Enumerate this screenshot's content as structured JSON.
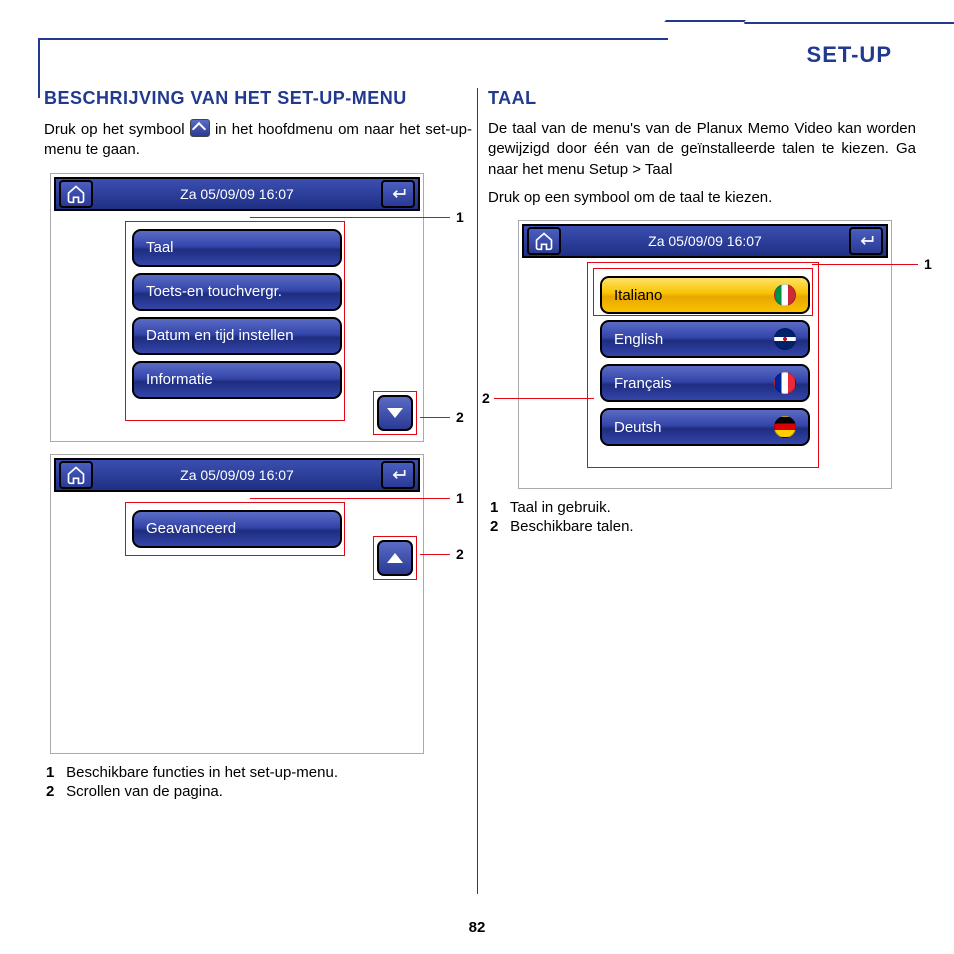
{
  "header": {
    "title": "SET-UP"
  },
  "page_number": "82",
  "left": {
    "heading": "BESCHRIJVING VAN HET SET-UP-MENU",
    "intro_a": "Druk op het symbool ",
    "intro_b": " in het hoofdmenu om naar het set-up-menu te gaan.",
    "screen1": {
      "date": "Za 05/09/09 16:07",
      "items": [
        "Taal",
        "Toets-en touchvergr.",
        "Datum en tijd instellen",
        "Informatie"
      ]
    },
    "screen2": {
      "date": "Za 05/09/09 16:07",
      "items": [
        "Geavanceerd"
      ]
    },
    "callouts": {
      "c1": "1",
      "c2": "2"
    },
    "legend": {
      "n1": "1",
      "t1": "Beschikbare functies in het set-up-menu.",
      "n2": "2",
      "t2": "Scrollen van de pagina."
    }
  },
  "right": {
    "heading": "TAAL",
    "p1": "De taal van de menu's van de Planux Memo Video kan worden gewijzigd door één van de geïnstalleerde talen te kiezen. Ga naar het menu Setup > Taal",
    "p2": "Druk op een symbool om de taal te kiezen.",
    "screen": {
      "date": "Za 05/09/09 16:07",
      "items": [
        {
          "label": "Italiano",
          "flag": "it",
          "selected": true
        },
        {
          "label": "English",
          "flag": "uk",
          "selected": false
        },
        {
          "label": "Français",
          "flag": "fr",
          "selected": false
        },
        {
          "label": "Deutsh",
          "flag": "de",
          "selected": false
        }
      ]
    },
    "callouts": {
      "c1": "1",
      "c2": "2"
    },
    "legend": {
      "n1": "1",
      "t1": "Taal in gebruik.",
      "n2": "2",
      "t2": "Beschikbare talen."
    }
  }
}
